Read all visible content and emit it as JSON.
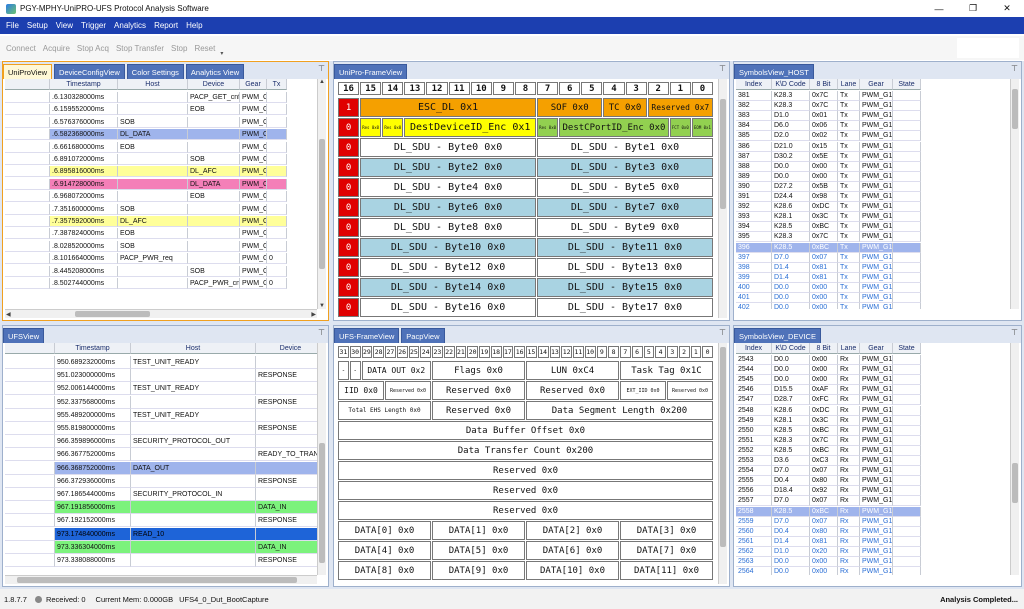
{
  "app": {
    "title": "PGY-MPHY-UniPRO-UFS Protocol Analysis Software",
    "min": "—",
    "max": "❐",
    "close": "✕"
  },
  "menu": [
    "File",
    "Setup",
    "View",
    "Trigger",
    "Analytics",
    "Report",
    "Help"
  ],
  "toolbar": [
    "Connect",
    "Acquire",
    "Stop Acq",
    "Stop Transfer",
    "Stop",
    "Reset"
  ],
  "unipro_tabs": [
    "UniProView",
    "DeviceConfigView",
    "Color Settings",
    "Analytics View"
  ],
  "unipro_cols": [
    "Timestamp",
    "Host",
    "Device",
    "Gear",
    "Tx"
  ],
  "unipro_rows": [
    {
      "ts": ".6.130328000ms",
      "host": "",
      "dev": "PACP_GET_cnf",
      "gear": "PWM_G1",
      "tx": "",
      "hl": ""
    },
    {
      "ts": ".6.159552000ms",
      "host": "",
      "dev": "EOB",
      "gear": "PWM_G1",
      "tx": "",
      "hl": ""
    },
    {
      "ts": ".6.576376000ms",
      "host": "SOB",
      "dev": "",
      "gear": "PWM_G1",
      "tx": "",
      "hl": ""
    },
    {
      "ts": ".6.582368000ms",
      "host": "DL_DATA",
      "dev": "",
      "gear": "PWM_G1",
      "tx": "",
      "hl": "blue"
    },
    {
      "ts": ".6.661680000ms",
      "host": "EOB",
      "dev": "",
      "gear": "PWM_G1",
      "tx": "",
      "hl": ""
    },
    {
      "ts": ".6.891072000ms",
      "host": "",
      "dev": "SOB",
      "gear": "PWM_G1",
      "tx": "",
      "hl": ""
    },
    {
      "ts": ".6.895816000ms",
      "host": "",
      "dev": "DL_AFC",
      "gear": "PWM_G1",
      "tx": "",
      "hl": "yellow"
    },
    {
      "ts": ".6.914728000ms",
      "host": "",
      "dev": "DL_DATA",
      "gear": "PWM_G1",
      "tx": "",
      "hl": "pink"
    },
    {
      "ts": ".6.968072000ms",
      "host": "",
      "dev": "EOB",
      "gear": "PWM_G1",
      "tx": "",
      "hl": ""
    },
    {
      "ts": ".7.351600000ms",
      "host": "SOB",
      "dev": "",
      "gear": "PWM_G1",
      "tx": "",
      "hl": ""
    },
    {
      "ts": ".7.357592000ms",
      "host": "DL_AFC",
      "dev": "",
      "gear": "PWM_G1",
      "tx": "",
      "hl": "yellow"
    },
    {
      "ts": ".7.387824000ms",
      "host": "EOB",
      "dev": "",
      "gear": "PWM_G1",
      "tx": "",
      "hl": ""
    },
    {
      "ts": ".8.028520000ms",
      "host": "SOB",
      "dev": "",
      "gear": "PWM_G1",
      "tx": "",
      "hl": ""
    },
    {
      "ts": ".8.101664000ms",
      "host": "PACP_PWR_req",
      "dev": "",
      "gear": "PWM_G1",
      "tx": "0",
      "hl": ""
    },
    {
      "ts": ".8.445208000ms",
      "host": "",
      "dev": "SOB",
      "gear": "PWM_G1",
      "tx": "",
      "hl": ""
    },
    {
      "ts": ".8.502744000ms",
      "host": "",
      "dev": "PACP_PWR_cnf",
      "gear": "PWM_G1",
      "tx": "0",
      "hl": ""
    }
  ],
  "unipro_frame": {
    "tab": "UniPro-FrameView",
    "bits": [
      "16",
      "15",
      "14",
      "13",
      "12",
      "11",
      "10",
      "9",
      "8",
      "7",
      "6",
      "5",
      "4",
      "3",
      "2",
      "1",
      "0"
    ],
    "row0": {
      "flag": "1",
      "a": "ESC_DL 0x1",
      "b": "SOF 0x0",
      "c": "TC 0x0",
      "d": "Reserved 0x7"
    },
    "row1": {
      "flag": "0",
      "a_small1": "Res 0x0",
      "a_small2": "Res 0x0",
      "a": "DestDeviceID_Enc  0x1",
      "b_small": "Res 0x0",
      "b": "DestCPortID_Enc  0x0",
      "c_small1": "FCT 0x0",
      "c_small2": "EOM 0x1"
    },
    "sdu": [
      [
        "DL_SDU - Byte0 0x0",
        "DL_SDU - Byte1 0x0"
      ],
      [
        "DL_SDU - Byte2 0x0",
        "DL_SDU - Byte3 0x0"
      ],
      [
        "DL_SDU - Byte4 0x0",
        "DL_SDU - Byte5 0x0"
      ],
      [
        "DL_SDU - Byte6 0x0",
        "DL_SDU - Byte7 0x0"
      ],
      [
        "DL_SDU - Byte8 0x0",
        "DL_SDU - Byte9 0x0"
      ],
      [
        "DL_SDU - Byte10 0x0",
        "DL_SDU - Byte11 0x0"
      ],
      [
        "DL_SDU - Byte12 0x0",
        "DL_SDU - Byte13 0x0"
      ],
      [
        "DL_SDU - Byte14 0x0",
        "DL_SDU - Byte15 0x0"
      ],
      [
        "DL_SDU - Byte16 0x0",
        "DL_SDU - Byte17 0x0"
      ]
    ],
    "sdu_flag": "0"
  },
  "sym_cols": [
    "Index",
    "K\\D Code",
    "8 Bit",
    "Lane",
    "Gear",
    "State"
  ],
  "sym_host": {
    "tab": "SymbolsView_HOST",
    "rows": [
      [
        "381",
        "K28.3",
        "0x7C",
        "Tx",
        "PWM_G1",
        ""
      ],
      [
        "382",
        "K28.3",
        "0x7C",
        "Tx",
        "PWM_G1",
        ""
      ],
      [
        "383",
        "D1.0",
        "0x01",
        "Tx",
        "PWM_G1",
        ""
      ],
      [
        "384",
        "D6.0",
        "0x06",
        "Tx",
        "PWM_G1",
        ""
      ],
      [
        "385",
        "D2.0",
        "0x02",
        "Tx",
        "PWM_G1",
        ""
      ],
      [
        "386",
        "D21.0",
        "0x15",
        "Tx",
        "PWM_G1",
        ""
      ],
      [
        "387",
        "D30.2",
        "0x5E",
        "Tx",
        "PWM_G1",
        ""
      ],
      [
        "388",
        "D0.0",
        "0x00",
        "Tx",
        "PWM_G1",
        ""
      ],
      [
        "389",
        "D0.0",
        "0x00",
        "Tx",
        "PWM_G1",
        ""
      ],
      [
        "390",
        "D27.2",
        "0x5B",
        "Tx",
        "PWM_G1",
        ""
      ],
      [
        "391",
        "D24.4",
        "0x98",
        "Tx",
        "PWM_G1",
        ""
      ],
      [
        "392",
        "K28.6",
        "0xDC",
        "Tx",
        "PWM_G1",
        ""
      ],
      [
        "393",
        "K28.1",
        "0x3C",
        "Tx",
        "PWM_G1",
        ""
      ],
      [
        "394",
        "K28.5",
        "0xBC",
        "Tx",
        "PWM_G1",
        ""
      ],
      [
        "395",
        "K28.3",
        "0x7C",
        "Tx",
        "PWM_G1",
        ""
      ],
      [
        "396",
        "K28.5",
        "0xBC",
        "Tx",
        "PWM_G1",
        ""
      ],
      [
        "397",
        "D7.0",
        "0x07",
        "Tx",
        "PWM_G1",
        ""
      ],
      [
        "398",
        "D1.4",
        "0x81",
        "Tx",
        "PWM_G1",
        ""
      ],
      [
        "399",
        "D1.4",
        "0x81",
        "Tx",
        "PWM_G1",
        ""
      ],
      [
        "400",
        "D0.0",
        "0x00",
        "Tx",
        "PWM_G1",
        ""
      ],
      [
        "401",
        "D0.0",
        "0x00",
        "Tx",
        "PWM_G1",
        ""
      ],
      [
        "402",
        "D0.0",
        "0x00",
        "Tx",
        "PWM_G1",
        ""
      ]
    ]
  },
  "ufs_view": {
    "tab": "UFSView",
    "cols": [
      "Timestamp",
      "Host",
      "Device"
    ],
    "rows": [
      {
        "ts": "950.689232000ms",
        "host": "TEST_UNIT_READY",
        "dev": "",
        "hl": ""
      },
      {
        "ts": "951.023000000ms",
        "host": "",
        "dev": "RESPONSE",
        "hl": ""
      },
      {
        "ts": "952.006144000ms",
        "host": "TEST_UNIT_READY",
        "dev": "",
        "hl": ""
      },
      {
        "ts": "952.337568000ms",
        "host": "",
        "dev": "RESPONSE",
        "hl": ""
      },
      {
        "ts": "955.489200000ms",
        "host": "TEST_UNIT_READY",
        "dev": "",
        "hl": ""
      },
      {
        "ts": "955.819800000ms",
        "host": "",
        "dev": "RESPONSE",
        "hl": ""
      },
      {
        "ts": "966.359896000ms",
        "host": "SECURITY_PROTOCOL_OUT",
        "dev": "",
        "hl": ""
      },
      {
        "ts": "966.367752000ms",
        "host": "",
        "dev": "READY_TO_TRANSF",
        "hl": ""
      },
      {
        "ts": "966.368752000ms",
        "host": "DATA_OUT",
        "dev": "",
        "hl": "blue"
      },
      {
        "ts": "966.372936000ms",
        "host": "",
        "dev": "RESPONSE",
        "hl": ""
      },
      {
        "ts": "967.186544000ms",
        "host": "SECURITY_PROTOCOL_IN",
        "dev": "",
        "hl": ""
      },
      {
        "ts": "967.191856000ms",
        "host": "",
        "dev": "DATA_IN",
        "hl": "green"
      },
      {
        "ts": "967.192152000ms",
        "host": "",
        "dev": "RESPONSE",
        "hl": ""
      },
      {
        "ts": "973.174840000ms",
        "host": "READ_10",
        "dev": "",
        "hl": "sel"
      },
      {
        "ts": "973.336304000ms",
        "host": "",
        "dev": "DATA_IN",
        "hl": "green"
      },
      {
        "ts": "973.338088000ms",
        "host": "",
        "dev": "RESPONSE",
        "hl": ""
      }
    ]
  },
  "ufs_frame": {
    "tabs": [
      "UFS-FrameView",
      "PacpView"
    ],
    "bits": [
      "31",
      "30",
      "29",
      "28",
      "27",
      "26",
      "25",
      "24",
      "23",
      "22",
      "21",
      "20",
      "19",
      "18",
      "17",
      "16",
      "15",
      "14",
      "13",
      "12",
      "11",
      "10",
      "9",
      "8",
      "7",
      "6",
      "5",
      "4",
      "3",
      "2",
      "1",
      "0"
    ],
    "r1": [
      "-",
      "-",
      "DATA OUT 0x2",
      "Flags 0x0",
      "LUN 0xC4",
      "Task Tag 0x1C"
    ],
    "r2": [
      "IID 0x0",
      "Reserved 0x0",
      "Reserved 0x0",
      "Reserved 0x0",
      "EXT_IID 0x0",
      "Reserved 0x0"
    ],
    "r3": [
      "Total EHS Length 0x0",
      "Reserved 0x0",
      "Data Segment Length 0x200"
    ],
    "full": [
      "Data Buffer Offset 0x0",
      "Data Transfer Count 0x200",
      "Reserved 0x0",
      "Reserved 0x0",
      "Reserved 0x0"
    ],
    "data": [
      [
        "DATA[0] 0x0",
        "DATA[1] 0x0",
        "DATA[2] 0x0",
        "DATA[3] 0x0"
      ],
      [
        "DATA[4] 0x0",
        "DATA[5] 0x0",
        "DATA[6] 0x0",
        "DATA[7] 0x0"
      ],
      [
        "DATA[8] 0x0",
        "DATA[9] 0x0",
        "DATA[10] 0x0",
        "DATA[11] 0x0"
      ]
    ]
  },
  "sym_dev": {
    "tab": "SymbolsView_DEVICE",
    "rows": [
      [
        "2543",
        "D0.0",
        "0x00",
        "Rx",
        "PWM_G1",
        ""
      ],
      [
        "2544",
        "D0.0",
        "0x00",
        "Rx",
        "PWM_G1",
        ""
      ],
      [
        "2545",
        "D0.0",
        "0x00",
        "Rx",
        "PWM_G1",
        ""
      ],
      [
        "2546",
        "D15.5",
        "0xAF",
        "Rx",
        "PWM_G1",
        ""
      ],
      [
        "2547",
        "D28.7",
        "0xFC",
        "Rx",
        "PWM_G1",
        ""
      ],
      [
        "2548",
        "K28.6",
        "0xDC",
        "Rx",
        "PWM_G1",
        ""
      ],
      [
        "2549",
        "K28.1",
        "0x3C",
        "Rx",
        "PWM_G1",
        ""
      ],
      [
        "2550",
        "K28.5",
        "0xBC",
        "Rx",
        "PWM_G1",
        ""
      ],
      [
        "2551",
        "K28.3",
        "0x7C",
        "Rx",
        "PWM_G1",
        ""
      ],
      [
        "2552",
        "K28.5",
        "0xBC",
        "Rx",
        "PWM_G1",
        ""
      ],
      [
        "2553",
        "D3.6",
        "0xC3",
        "Rx",
        "PWM_G1",
        ""
      ],
      [
        "2554",
        "D7.0",
        "0x07",
        "Rx",
        "PWM_G1",
        ""
      ],
      [
        "2555",
        "D0.4",
        "0x80",
        "Rx",
        "PWM_G1",
        ""
      ],
      [
        "2556",
        "D18.4",
        "0x92",
        "Rx",
        "PWM_G1",
        ""
      ],
      [
        "2557",
        "D7.0",
        "0x07",
        "Rx",
        "PWM_G1",
        ""
      ],
      [
        "2558",
        "K28.5",
        "0xBC",
        "Rx",
        "PWM_G1",
        ""
      ],
      [
        "2559",
        "D7.0",
        "0x07",
        "Rx",
        "PWM_G1",
        ""
      ],
      [
        "2560",
        "D0.4",
        "0x80",
        "Rx",
        "PWM_G1",
        ""
      ],
      [
        "2561",
        "D1.4",
        "0x81",
        "Rx",
        "PWM_G1",
        ""
      ],
      [
        "2562",
        "D1.0",
        "0x20",
        "Rx",
        "PWM_G1",
        ""
      ],
      [
        "2563",
        "D0.0",
        "0x00",
        "Rx",
        "PWM_G1",
        ""
      ],
      [
        "2564",
        "D0.0",
        "0x00",
        "Rx",
        "PWM_G1",
        ""
      ]
    ]
  },
  "status": {
    "version": "1.8.7.7",
    "received": "Received: 0",
    "mem": "Current Mem: 0.000GB",
    "file": "UFS4_0_Dut_BootCapture",
    "done": "Analysis Completed..."
  },
  "colors": {
    "accent": "#1c3fb0",
    "row_blue": "#9fb4ec",
    "row_yellow": "#ffff99",
    "row_pink": "#f47fb8",
    "row_green": "#7cf27c",
    "row_sel": "#1e64d8",
    "sdu_cell": "#a9d3e2",
    "flag_red": "#e00000",
    "esc_orange": "#f5a000",
    "dest_yellow": "#ffff00",
    "port_green": "#92d050"
  }
}
